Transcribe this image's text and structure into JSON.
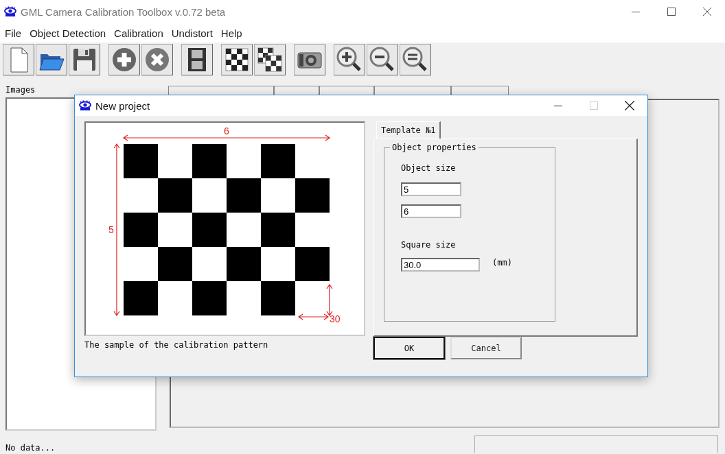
{
  "window": {
    "title": "GML Camera Calibration Toolbox  v.0.72 beta"
  },
  "menu": [
    "File",
    "Object Detection",
    "Calibration",
    "Undistort",
    "Help"
  ],
  "toolbar": [
    {
      "kind": "new"
    },
    {
      "kind": "open"
    },
    {
      "kind": "save"
    },
    {
      "kind": "add"
    },
    {
      "kind": "remove"
    },
    {
      "kind": "film"
    },
    {
      "kind": "board"
    },
    {
      "kind": "boards"
    },
    {
      "kind": "camera"
    },
    {
      "kind": "zoom-in"
    },
    {
      "kind": "zoom-out"
    },
    {
      "kind": "zoom-fit"
    }
  ],
  "images_panel": {
    "label": "Images"
  },
  "status_bar": {
    "text": "No data..."
  },
  "dialog": {
    "title": "New project",
    "pattern": {
      "cols_label": "6",
      "rows_label": "5",
      "square_label": "30",
      "caption": "The sample of the calibration pattern"
    },
    "tabs": [
      {
        "label": "Template №1",
        "selected": true
      }
    ],
    "group": {
      "title": "Object properties",
      "size_label": "Object size",
      "rows_value": "5",
      "cols_value": "6",
      "square_label": "Square size",
      "square_value": "30.0",
      "unit": "(mm)"
    },
    "buttons": [
      {
        "label": "OK",
        "default": true
      },
      {
        "label": "Cancel",
        "default": false
      }
    ]
  }
}
